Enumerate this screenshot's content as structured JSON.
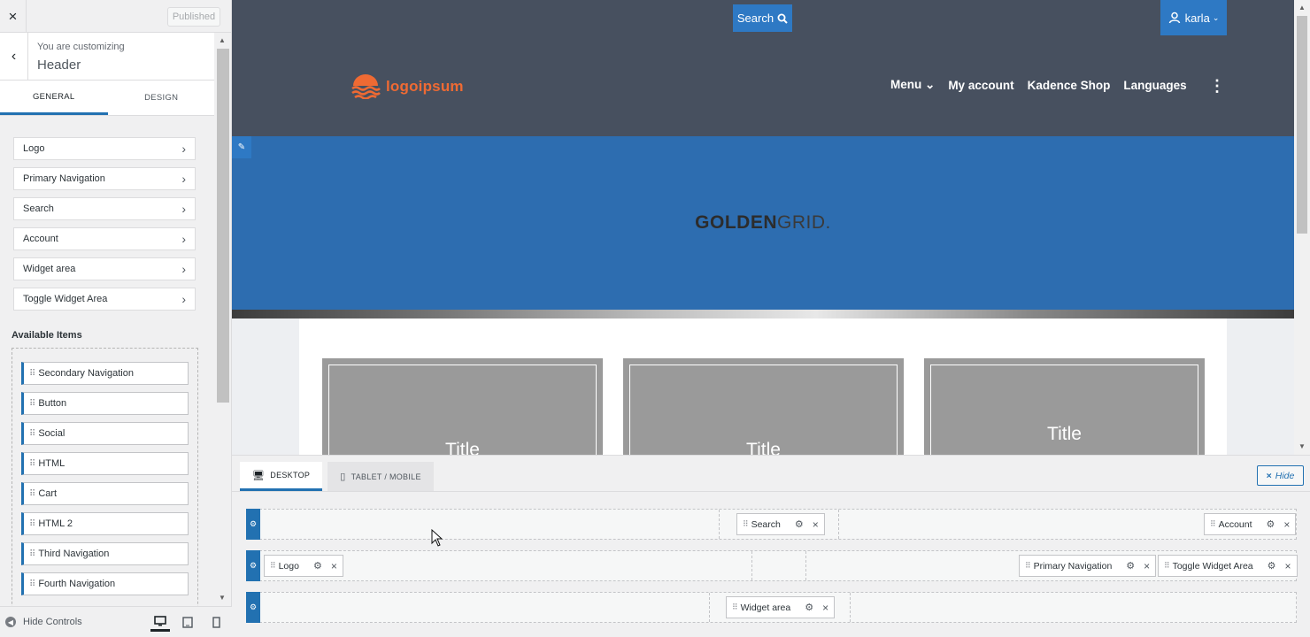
{
  "sidebar": {
    "close_icon": "×",
    "publish_label": "Published",
    "back_icon": "‹",
    "customizing_pre": "You are customizing",
    "section_title": "Header",
    "tabs": [
      {
        "label": "GENERAL"
      },
      {
        "label": "DESIGN"
      }
    ],
    "nav_items": [
      {
        "label": "Logo"
      },
      {
        "label": "Primary Navigation"
      },
      {
        "label": "Search"
      },
      {
        "label": "Account"
      },
      {
        "label": "Widget area"
      },
      {
        "label": "Toggle Widget Area"
      }
    ],
    "available_title": "Available Items",
    "available_items": [
      {
        "label": "Secondary Navigation"
      },
      {
        "label": "Button"
      },
      {
        "label": "Social"
      },
      {
        "label": "HTML"
      },
      {
        "label": "Cart"
      },
      {
        "label": "HTML 2"
      },
      {
        "label": "Third Navigation"
      },
      {
        "label": "Fourth Navigation"
      }
    ],
    "footer": {
      "hide_controls": "Hide Controls"
    }
  },
  "preview": {
    "search_button": "Search",
    "account_label": "karla",
    "logo_text": "logoipsum",
    "nav": [
      {
        "label": "Menu ⌄"
      },
      {
        "label": "My account"
      },
      {
        "label": "Kadence Shop"
      },
      {
        "label": "Languages"
      }
    ],
    "more_icon": "⋮",
    "hero_brand_bold": "GOLDEN",
    "hero_brand_light": "GRID.",
    "cards": [
      {
        "title": "Title"
      },
      {
        "title": "Title"
      },
      {
        "title": "Title"
      }
    ]
  },
  "builder": {
    "tabs": [
      {
        "label": "DESKTOP"
      },
      {
        "label": "TABLET / MOBILE"
      }
    ],
    "hide_label": "Hide",
    "rows": {
      "top": {
        "center": "Search",
        "right": "Account"
      },
      "main": {
        "left": "Logo",
        "right_1": "Primary Navigation",
        "right_2": "Toggle Widget Area"
      },
      "bottom": {
        "center": "Widget area"
      }
    }
  },
  "colors": {
    "accent": "#2271b1",
    "header_bg": "#47505f",
    "hero_bg": "#2d6db0",
    "logo": "#ef6a33"
  }
}
